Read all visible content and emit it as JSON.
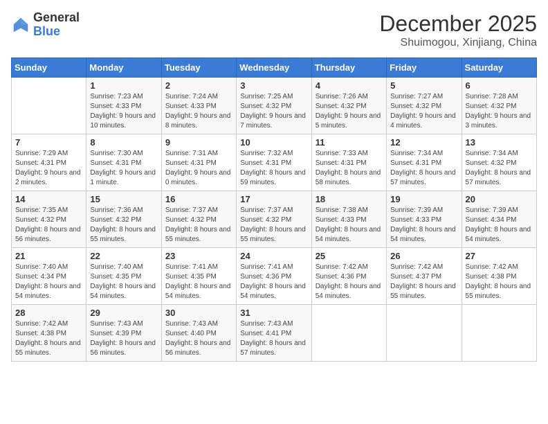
{
  "logo": {
    "general": "General",
    "blue": "Blue"
  },
  "header": {
    "month": "December 2025",
    "location": "Shuimogou, Xinjiang, China"
  },
  "weekdays": [
    "Sunday",
    "Monday",
    "Tuesday",
    "Wednesday",
    "Thursday",
    "Friday",
    "Saturday"
  ],
  "weeks": [
    [
      {
        "day": "",
        "sunrise": "",
        "sunset": "",
        "daylight": ""
      },
      {
        "day": "1",
        "sunrise": "Sunrise: 7:23 AM",
        "sunset": "Sunset: 4:33 PM",
        "daylight": "Daylight: 9 hours and 10 minutes."
      },
      {
        "day": "2",
        "sunrise": "Sunrise: 7:24 AM",
        "sunset": "Sunset: 4:33 PM",
        "daylight": "Daylight: 9 hours and 8 minutes."
      },
      {
        "day": "3",
        "sunrise": "Sunrise: 7:25 AM",
        "sunset": "Sunset: 4:32 PM",
        "daylight": "Daylight: 9 hours and 7 minutes."
      },
      {
        "day": "4",
        "sunrise": "Sunrise: 7:26 AM",
        "sunset": "Sunset: 4:32 PM",
        "daylight": "Daylight: 9 hours and 5 minutes."
      },
      {
        "day": "5",
        "sunrise": "Sunrise: 7:27 AM",
        "sunset": "Sunset: 4:32 PM",
        "daylight": "Daylight: 9 hours and 4 minutes."
      },
      {
        "day": "6",
        "sunrise": "Sunrise: 7:28 AM",
        "sunset": "Sunset: 4:32 PM",
        "daylight": "Daylight: 9 hours and 3 minutes."
      }
    ],
    [
      {
        "day": "7",
        "sunrise": "Sunrise: 7:29 AM",
        "sunset": "Sunset: 4:31 PM",
        "daylight": "Daylight: 9 hours and 2 minutes."
      },
      {
        "day": "8",
        "sunrise": "Sunrise: 7:30 AM",
        "sunset": "Sunset: 4:31 PM",
        "daylight": "Daylight: 9 hours and 1 minute."
      },
      {
        "day": "9",
        "sunrise": "Sunrise: 7:31 AM",
        "sunset": "Sunset: 4:31 PM",
        "daylight": "Daylight: 9 hours and 0 minutes."
      },
      {
        "day": "10",
        "sunrise": "Sunrise: 7:32 AM",
        "sunset": "Sunset: 4:31 PM",
        "daylight": "Daylight: 8 hours and 59 minutes."
      },
      {
        "day": "11",
        "sunrise": "Sunrise: 7:33 AM",
        "sunset": "Sunset: 4:31 PM",
        "daylight": "Daylight: 8 hours and 58 minutes."
      },
      {
        "day": "12",
        "sunrise": "Sunrise: 7:34 AM",
        "sunset": "Sunset: 4:31 PM",
        "daylight": "Daylight: 8 hours and 57 minutes."
      },
      {
        "day": "13",
        "sunrise": "Sunrise: 7:34 AM",
        "sunset": "Sunset: 4:32 PM",
        "daylight": "Daylight: 8 hours and 57 minutes."
      }
    ],
    [
      {
        "day": "14",
        "sunrise": "Sunrise: 7:35 AM",
        "sunset": "Sunset: 4:32 PM",
        "daylight": "Daylight: 8 hours and 56 minutes."
      },
      {
        "day": "15",
        "sunrise": "Sunrise: 7:36 AM",
        "sunset": "Sunset: 4:32 PM",
        "daylight": "Daylight: 8 hours and 55 minutes."
      },
      {
        "day": "16",
        "sunrise": "Sunrise: 7:37 AM",
        "sunset": "Sunset: 4:32 PM",
        "daylight": "Daylight: 8 hours and 55 minutes."
      },
      {
        "day": "17",
        "sunrise": "Sunrise: 7:37 AM",
        "sunset": "Sunset: 4:32 PM",
        "daylight": "Daylight: 8 hours and 55 minutes."
      },
      {
        "day": "18",
        "sunrise": "Sunrise: 7:38 AM",
        "sunset": "Sunset: 4:33 PM",
        "daylight": "Daylight: 8 hours and 54 minutes."
      },
      {
        "day": "19",
        "sunrise": "Sunrise: 7:39 AM",
        "sunset": "Sunset: 4:33 PM",
        "daylight": "Daylight: 8 hours and 54 minutes."
      },
      {
        "day": "20",
        "sunrise": "Sunrise: 7:39 AM",
        "sunset": "Sunset: 4:34 PM",
        "daylight": "Daylight: 8 hours and 54 minutes."
      }
    ],
    [
      {
        "day": "21",
        "sunrise": "Sunrise: 7:40 AM",
        "sunset": "Sunset: 4:34 PM",
        "daylight": "Daylight: 8 hours and 54 minutes."
      },
      {
        "day": "22",
        "sunrise": "Sunrise: 7:40 AM",
        "sunset": "Sunset: 4:35 PM",
        "daylight": "Daylight: 8 hours and 54 minutes."
      },
      {
        "day": "23",
        "sunrise": "Sunrise: 7:41 AM",
        "sunset": "Sunset: 4:35 PM",
        "daylight": "Daylight: 8 hours and 54 minutes."
      },
      {
        "day": "24",
        "sunrise": "Sunrise: 7:41 AM",
        "sunset": "Sunset: 4:36 PM",
        "daylight": "Daylight: 8 hours and 54 minutes."
      },
      {
        "day": "25",
        "sunrise": "Sunrise: 7:42 AM",
        "sunset": "Sunset: 4:36 PM",
        "daylight": "Daylight: 8 hours and 54 minutes."
      },
      {
        "day": "26",
        "sunrise": "Sunrise: 7:42 AM",
        "sunset": "Sunset: 4:37 PM",
        "daylight": "Daylight: 8 hours and 55 minutes."
      },
      {
        "day": "27",
        "sunrise": "Sunrise: 7:42 AM",
        "sunset": "Sunset: 4:38 PM",
        "daylight": "Daylight: 8 hours and 55 minutes."
      }
    ],
    [
      {
        "day": "28",
        "sunrise": "Sunrise: 7:42 AM",
        "sunset": "Sunset: 4:38 PM",
        "daylight": "Daylight: 8 hours and 55 minutes."
      },
      {
        "day": "29",
        "sunrise": "Sunrise: 7:43 AM",
        "sunset": "Sunset: 4:39 PM",
        "daylight": "Daylight: 8 hours and 56 minutes."
      },
      {
        "day": "30",
        "sunrise": "Sunrise: 7:43 AM",
        "sunset": "Sunset: 4:40 PM",
        "daylight": "Daylight: 8 hours and 56 minutes."
      },
      {
        "day": "31",
        "sunrise": "Sunrise: 7:43 AM",
        "sunset": "Sunset: 4:41 PM",
        "daylight": "Daylight: 8 hours and 57 minutes."
      },
      {
        "day": "",
        "sunrise": "",
        "sunset": "",
        "daylight": ""
      },
      {
        "day": "",
        "sunrise": "",
        "sunset": "",
        "daylight": ""
      },
      {
        "day": "",
        "sunrise": "",
        "sunset": "",
        "daylight": ""
      }
    ]
  ]
}
